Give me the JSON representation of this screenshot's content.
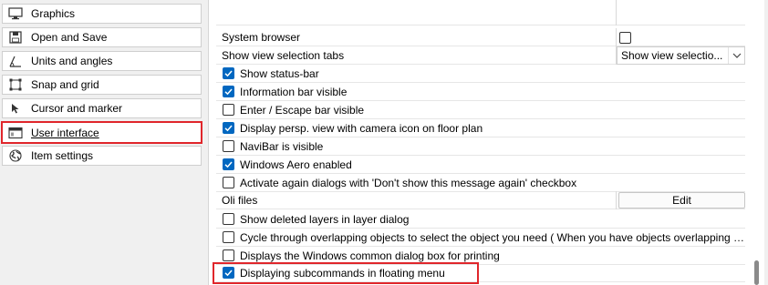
{
  "sidebar": {
    "items": [
      {
        "label": "Graphics",
        "icon": "monitor-icon"
      },
      {
        "label": "Open and Save",
        "icon": "disk-icon"
      },
      {
        "label": "Units and angles",
        "icon": "angle-icon"
      },
      {
        "label": "Snap and grid",
        "icon": "snap-grid-icon"
      },
      {
        "label": "Cursor and marker",
        "icon": "cursor-icon"
      },
      {
        "label": "User interface",
        "icon": "window-icon",
        "selected": true
      },
      {
        "label": "Item settings",
        "icon": "globe-icon"
      }
    ]
  },
  "settings": {
    "system_browser": {
      "label": "System browser",
      "checked": false
    },
    "show_view_selection_tabs": {
      "label": "Show view selection tabs",
      "value": "Show view selectio..."
    },
    "show_status_bar": {
      "label": "Show status-bar",
      "checked": true
    },
    "information_bar_visible": {
      "label": "Information bar visible",
      "checked": true
    },
    "enter_escape_bar_visible": {
      "label": "Enter / Escape bar visible",
      "checked": false
    },
    "display_persp_view": {
      "label": "Display persp. view with camera icon on floor plan",
      "checked": true
    },
    "navibar_visible": {
      "label": "NaviBar is visible",
      "checked": false
    },
    "windows_aero_enabled": {
      "label": "Windows Aero enabled",
      "checked": true
    },
    "activate_again_dialogs": {
      "label": "Activate again dialogs with 'Don't show this message again' checkbox",
      "checked": false
    },
    "oli_files": {
      "label": "Oli files",
      "button": "Edit"
    },
    "show_deleted_layers": {
      "label": "Show deleted layers in layer dialog",
      "checked": false
    },
    "cycle_overlapping": {
      "label": "Cycle through overlapping objects to select the object you need ( When you have objects overlapping on the...",
      "checked": false
    },
    "windows_common_dialog": {
      "label": "Displays the Windows common dialog box for printing",
      "checked": false
    },
    "subcommands_floating_menu": {
      "label": "Displaying subcommands in floating menu",
      "checked": true
    }
  },
  "colors": {
    "highlight": "#e0262b",
    "checkbox_checked": "#0067c0"
  }
}
